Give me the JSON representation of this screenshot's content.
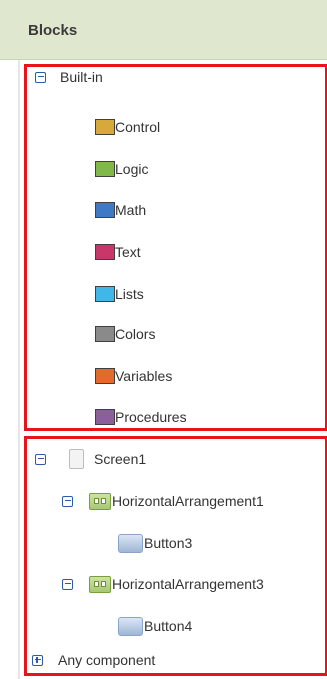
{
  "header": {
    "title": "Blocks"
  },
  "builtin": {
    "label": "Built-in",
    "items": [
      {
        "label": "Control",
        "color": "#d7a93b"
      },
      {
        "label": "Logic",
        "color": "#81b84a"
      },
      {
        "label": "Math",
        "color": "#3f78c4"
      },
      {
        "label": "Text",
        "color": "#c8366a"
      },
      {
        "label": "Lists",
        "color": "#3fb7e8"
      },
      {
        "label": "Colors",
        "color": "#8a8a8a"
      },
      {
        "label": "Variables",
        "color": "#e26a2b"
      },
      {
        "label": "Procedures",
        "color": "#8b5e9c"
      }
    ]
  },
  "components": {
    "screen": {
      "label": "Screen1"
    },
    "arrangements": [
      {
        "label": "HorizontalArrangement1",
        "child": "Button3"
      },
      {
        "label": "HorizontalArrangement3",
        "child": "Button4"
      }
    ],
    "any_component": {
      "label": "Any component"
    }
  },
  "colors": {
    "highlight_border": "#e8141c",
    "header_bg": "#dfe7cf"
  }
}
